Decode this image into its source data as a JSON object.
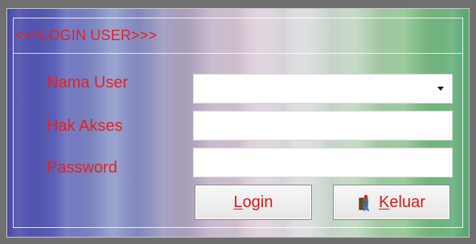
{
  "form": {
    "title": "<<<LOGIN USER>>>",
    "fields": [
      {
        "label": "Nama User",
        "value": ""
      },
      {
        "label": "Hak Akses",
        "value": ""
      },
      {
        "label": "Password",
        "value": ""
      }
    ]
  },
  "buttons": {
    "login": {
      "mnemonic": "L",
      "rest": "ogin"
    },
    "exit": {
      "mnemonic": "K",
      "rest": "eluar"
    }
  },
  "colors": {
    "label": "#e82020",
    "button_text": "#d81a1a",
    "dialog_border": "#707070"
  },
  "icons": {
    "exit": "door-exit-icon",
    "dropdown": "chevron-down-icon"
  }
}
